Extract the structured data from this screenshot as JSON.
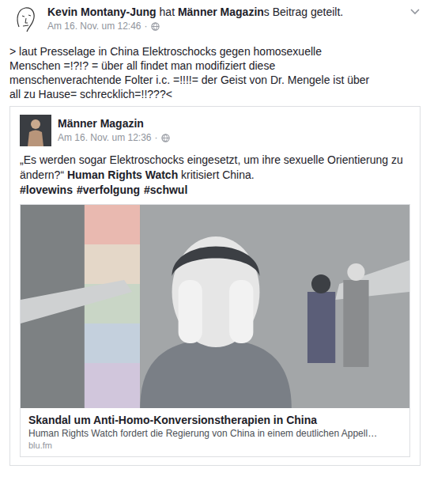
{
  "header": {
    "sharer": "Kevin Montany-Jung",
    "action": " hat ",
    "page": "Männer Magazin",
    "page_suffix": "s Beitrag geteilt.",
    "time": "Am 16. Nov. um 12:46",
    "separator": "·"
  },
  "post_lines": [
    "> laut Presselage in China Elektroschocks gegen homosexuelle",
    "Menschen =!?!? = über all findet man  modifiziert diese",
    "menschenverachtende Folter i.c. =!!!!= der Geist von Dr. Mengele ist über",
    "all zu Hause= schrecklich=!!???<"
  ],
  "shared_post": {
    "author": "Männer Magazin",
    "time": "Am 16. Nov. um 12:36",
    "separator": "·",
    "text_parts": [
      {
        "text": "„Es werden sogar Elektroschocks eingesetzt, um ihre sexuelle Orientierung zu ändern?“ ",
        "bold": false
      },
      {
        "text": "Human Rights Watch",
        "bold": true
      },
      {
        "text": " kritisiert China.",
        "bold": false
      }
    ],
    "hashtags": [
      "#lovewins",
      "#verfolgung",
      "#schwul"
    ],
    "link": {
      "title": "Skandal um Anti-Homo-Konversionstherapien in China",
      "description": "Human Rights Watch fordert die Regierung von China in einem deutlichen Appell…",
      "domain": "blu.fm"
    }
  }
}
